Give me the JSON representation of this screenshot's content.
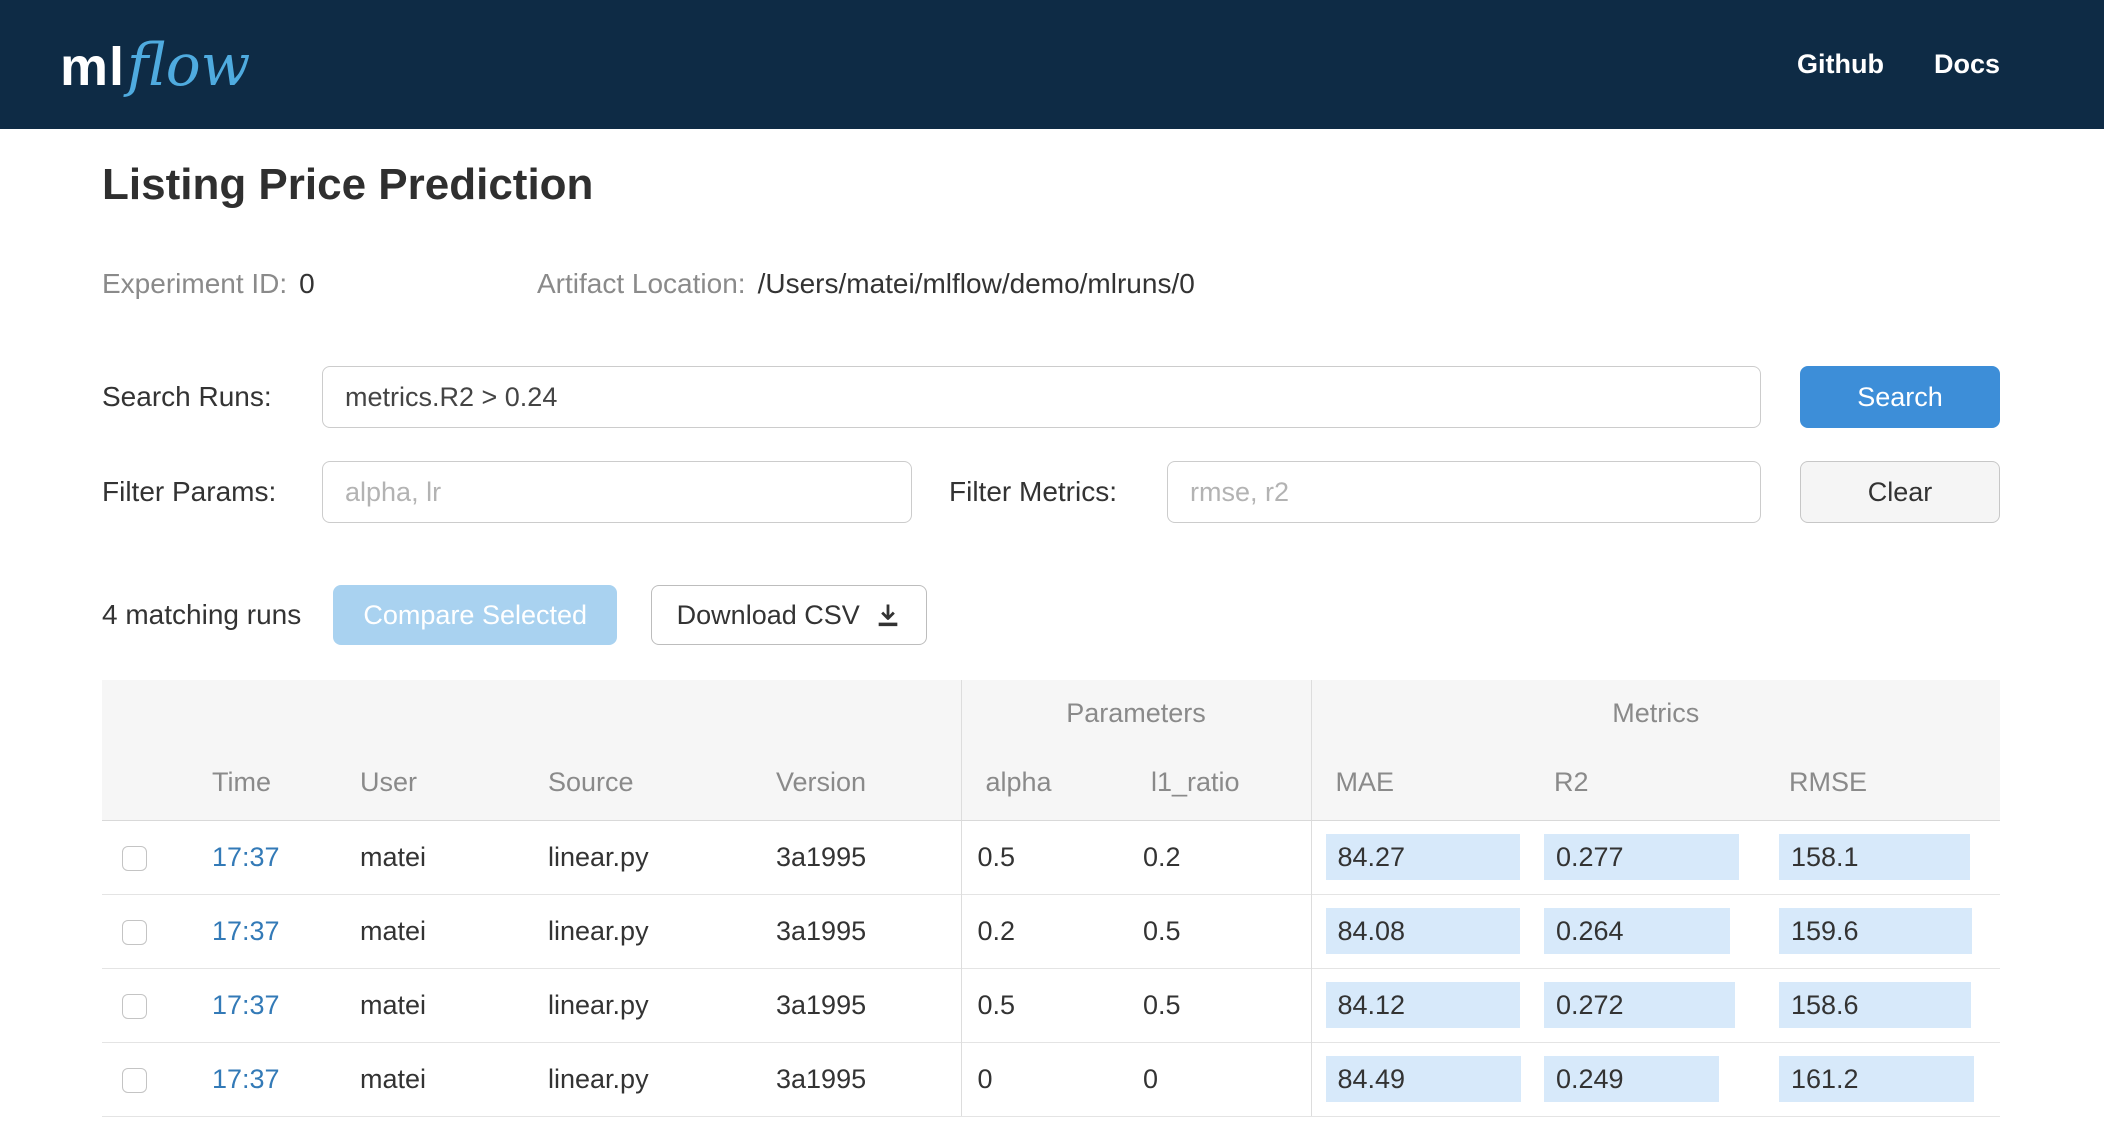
{
  "header": {
    "logo_ml": "ml",
    "logo_flow": "flow",
    "nav": [
      {
        "label": "Github"
      },
      {
        "label": "Docs"
      }
    ]
  },
  "page": {
    "title": "Listing Price Prediction",
    "experiment_id_label": "Experiment ID:",
    "experiment_id": "0",
    "artifact_location_label": "Artifact Location:",
    "artifact_location": "/Users/matei/mlflow/demo/mlruns/0"
  },
  "search": {
    "search_runs_label": "Search Runs:",
    "search_value": "metrics.R2 > 0.24",
    "search_button": "Search",
    "filter_params_label": "Filter Params:",
    "filter_params_placeholder": "alpha, lr",
    "filter_metrics_label": "Filter Metrics:",
    "filter_metrics_placeholder": "rmse, r2",
    "clear_button": "Clear"
  },
  "actions": {
    "matching_runs": "4 matching runs",
    "compare_button": "Compare Selected",
    "download_button": "Download CSV",
    "download_icon": "download-icon"
  },
  "table": {
    "group_headers": [
      "Parameters",
      "Metrics"
    ],
    "columns": [
      "Time",
      "User",
      "Source",
      "Version",
      "alpha",
      "l1_ratio",
      "MAE",
      "R2",
      "RMSE"
    ],
    "rows": [
      {
        "time": "17:37",
        "user": "matei",
        "source": "linear.py",
        "version": "3a1995",
        "alpha": "0.5",
        "l1_ratio": "0.2",
        "mae": "84.27",
        "r2": "0.277",
        "rmse": "158.1"
      },
      {
        "time": "17:37",
        "user": "matei",
        "source": "linear.py",
        "version": "3a1995",
        "alpha": "0.2",
        "l1_ratio": "0.5",
        "mae": "84.08",
        "r2": "0.264",
        "rmse": "159.6"
      },
      {
        "time": "17:37",
        "user": "matei",
        "source": "linear.py",
        "version": "3a1995",
        "alpha": "0.5",
        "l1_ratio": "0.5",
        "mae": "84.12",
        "r2": "0.272",
        "rmse": "158.6"
      },
      {
        "time": "17:37",
        "user": "matei",
        "source": "linear.py",
        "version": "3a1995",
        "alpha": "0",
        "l1_ratio": "0",
        "mae": "84.49",
        "r2": "0.249",
        "rmse": "161.2"
      }
    ]
  },
  "colors": {
    "header_bg": "#0e2b45",
    "logo_flow_blue": "#4fabdf",
    "primary_button_blue": "#3d8ed8",
    "disabled_button_blue": "#a9d2f0",
    "metric_highlight": "#d7e9fa",
    "link_blue": "#337ab7"
  }
}
